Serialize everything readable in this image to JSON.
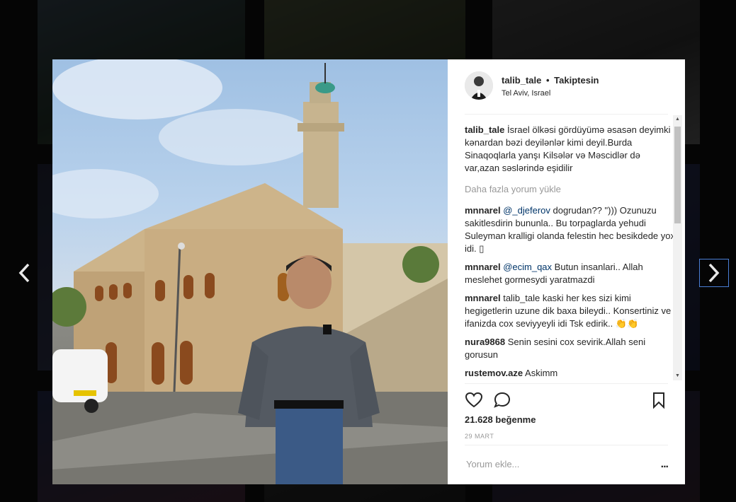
{
  "post": {
    "username": "talib_tale",
    "separator": "•",
    "follow_label": "Takiptesin",
    "location": "Tel Aviv, Israel",
    "likes": "21.628 beğenme",
    "date": "29 MART",
    "add_comment_placeholder": "Yorum ekle...",
    "more_options": "..."
  },
  "caption": {
    "username": "talib_tale",
    "text": "İsrael ölkəsi gördüyümə əsasən deyimki kənardan bəzi deyilənlər kimi deyil.Burda Sinaqoqlarla yanşı Kilsələr və Məscidlər də var,azan səslərində eşidilir"
  },
  "load_more": "Daha fazla yorum yükle",
  "comments": [
    {
      "username": "mnnarel",
      "mention": "@_djeferov",
      "text": "dogrudan?? \")))\nOzunuzu sakitlesdirin bununla.. Bu torpaglarda yehudi Suleyman kralligi olanda felestin hec besikdede yox idi. ▯"
    },
    {
      "username": "mnnarel",
      "mention": "@ecim_qax",
      "text": "Butun insanlari.. Allah meslehet gormesydi yaratmazdi"
    },
    {
      "username": "mnnarel",
      "mention": "",
      "text": "talib_tale kaski her kes sizi kimi hegigetlerin uzune dik baxa bileydi.. Konsertiniz ve ifanizda cox seviyyeyli idi Tsk edirik.. 👏👏"
    },
    {
      "username": "nura9868",
      "mention": "",
      "text": "Senin sesini cox sevirik.Allah seni gorusun"
    },
    {
      "username": "rustemov.aze",
      "mention": "",
      "text": "Askimm"
    }
  ],
  "icons": {
    "like": "heart-icon",
    "comment": "speech-bubble-icon",
    "save": "bookmark-icon",
    "prev": "chevron-left-icon",
    "next": "chevron-right-icon"
  },
  "colors": {
    "link": "#003569",
    "muted": "#999999",
    "nav_focus": "#4a7fd6"
  }
}
